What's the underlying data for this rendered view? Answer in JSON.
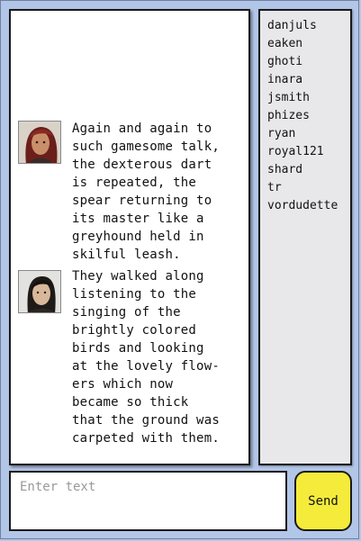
{
  "messages": [
    {
      "avatar": "woman-portrait-avatar",
      "text": "Again and again to\nsuch gamesome talk,\nthe dexterous dart\nis repeated, the\nspear returning to\nits master like a\ngreyhound held in\nskilful leash."
    },
    {
      "avatar": "man-portrait-avatar",
      "text": "They walked along\nlistening to the\nsinging of the\nbrightly colored\nbirds and looking\nat the lovely flow-\ners which now\nbecame so thick\nthat the ground was\ncarpeted with them."
    }
  ],
  "users": [
    "danjuls",
    "eaken",
    "ghoti",
    "inara",
    "jsmith",
    "phizes",
    "ryan",
    "royal121",
    "shard",
    "tr",
    "vordudette"
  ],
  "input": {
    "placeholder": "Enter text",
    "value": ""
  },
  "send_label": "Send",
  "colors": {
    "background": "#b2c6e8",
    "send_button": "#f5eb3b",
    "user_list": "#e8e8ea"
  }
}
